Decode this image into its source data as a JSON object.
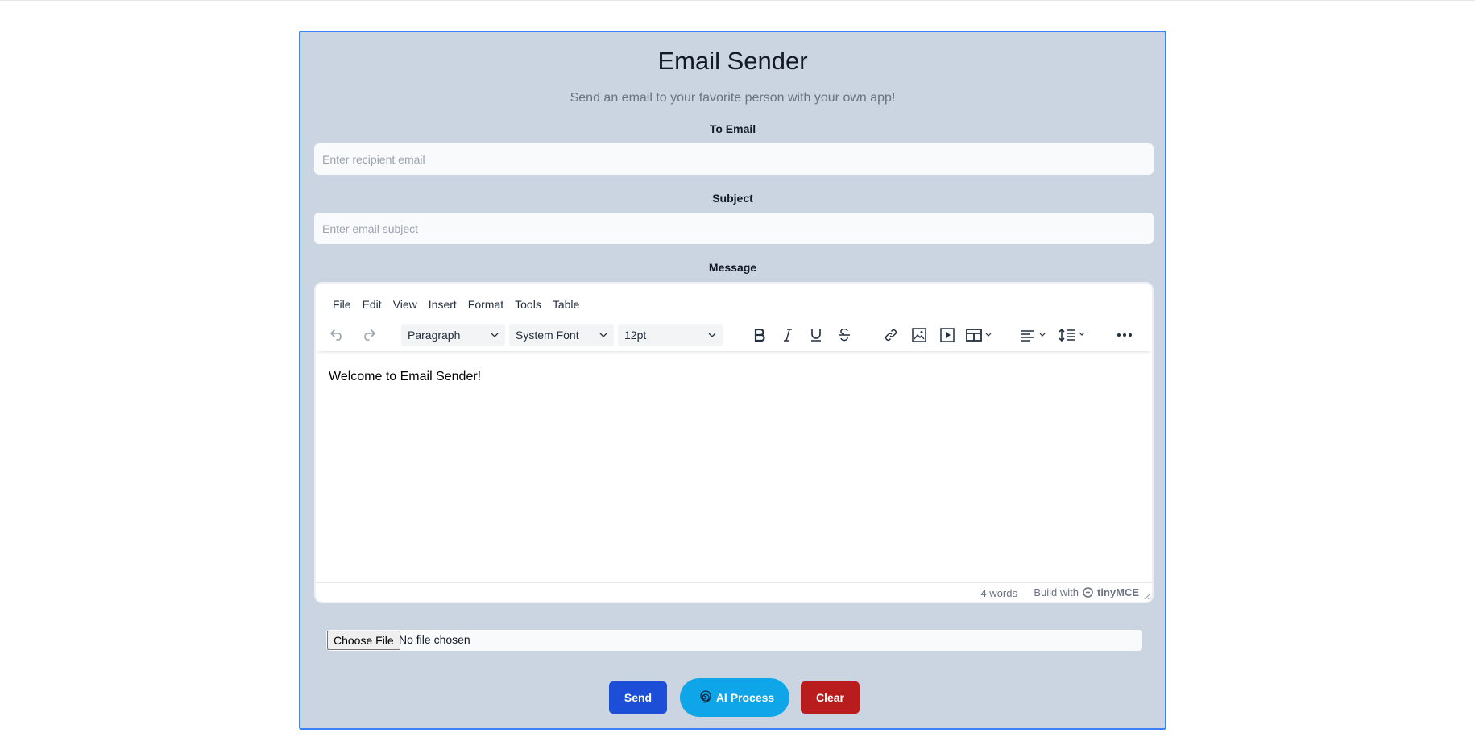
{
  "header": {
    "title": "Email Sender",
    "subtitle": "Send an email to your favorite person with your own app!"
  },
  "form": {
    "to_label": "To Email",
    "to_placeholder": "Enter recipient email",
    "to_value": "",
    "subject_label": "Subject",
    "subject_placeholder": "Enter email subject",
    "subject_value": "",
    "message_label": "Message"
  },
  "editor": {
    "menu": [
      "File",
      "Edit",
      "View",
      "Insert",
      "Format",
      "Tools",
      "Table"
    ],
    "block_format": "Paragraph",
    "font_family": "System Font",
    "font_size": "12pt",
    "content": "Welcome to Email Sender!",
    "word_count": "4 words",
    "branding_prefix": "Build with",
    "branding_name": "tinyMCE"
  },
  "attachment": {
    "button_label": "Choose File",
    "status": "No file chosen"
  },
  "actions": {
    "send_label": "Send",
    "ai_label": "AI Process",
    "clear_label": "Clear"
  },
  "colors": {
    "card_bg": "#cbd5e1",
    "card_border": "#3b82f6",
    "send": "#1d4ed8",
    "ai": "#0ea5e9",
    "clear": "#b91c1c"
  }
}
